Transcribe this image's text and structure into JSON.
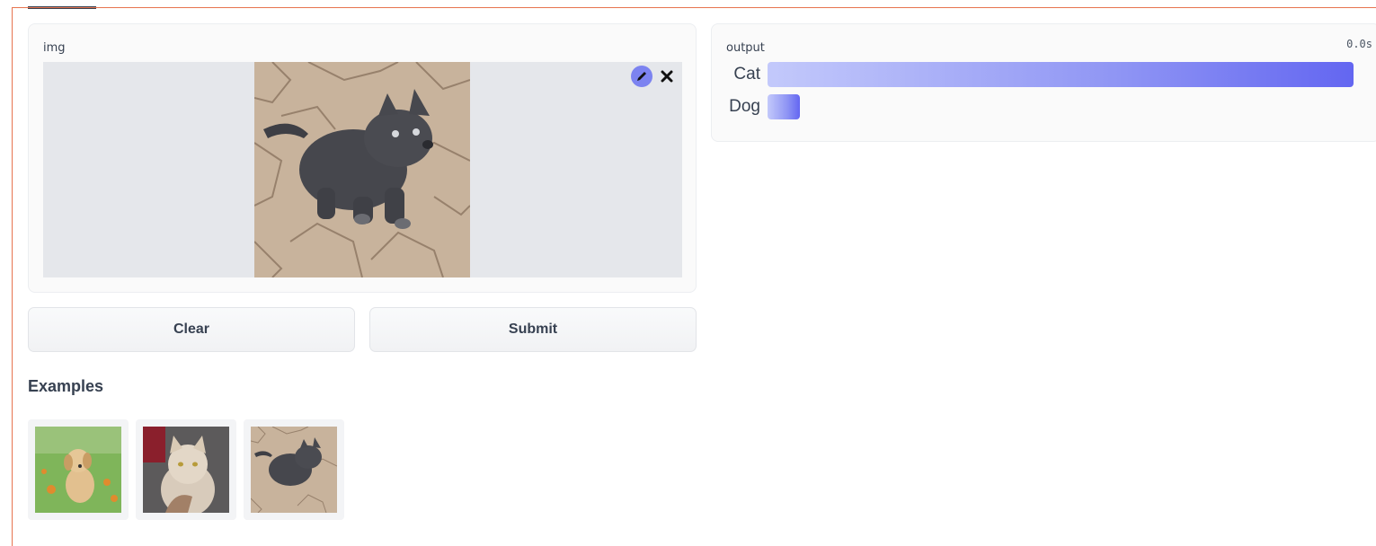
{
  "input": {
    "label": "img"
  },
  "buttons": {
    "clear": "Clear",
    "submit": "Submit"
  },
  "examples": {
    "title": "Examples",
    "items": [
      "puppy-on-grass",
      "cream-cat",
      "gray-kitten-on-tiles"
    ]
  },
  "output": {
    "label": "output",
    "timer": "0.0s",
    "predictions": [
      {
        "label": "Cat",
        "confidence": 1.0
      },
      {
        "label": "Dog",
        "confidence": 0.055
      }
    ]
  },
  "colors": {
    "accent": "#6366f1",
    "frame_border": "#e7744f"
  },
  "icons": {
    "edit": "pencil-icon",
    "clear_image": "close-icon"
  }
}
